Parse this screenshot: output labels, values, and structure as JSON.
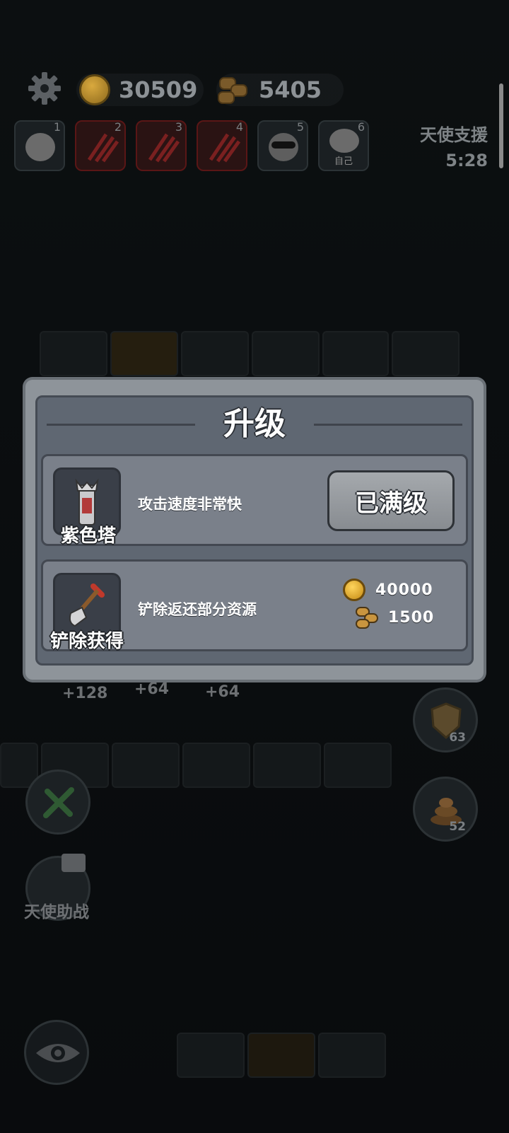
{
  "hud": {
    "coins": "30509",
    "wood": "5405",
    "angel_support_label": "天使支援",
    "angel_support_timer": "5:28"
  },
  "players": [
    {
      "num": "1",
      "state": "player"
    },
    {
      "num": "2",
      "state": "dead"
    },
    {
      "num": "3",
      "state": "dead"
    },
    {
      "num": "4",
      "state": "dead"
    },
    {
      "num": "5",
      "state": "player"
    },
    {
      "num": "6",
      "state": "self",
      "self_label": "自己"
    }
  ],
  "modal": {
    "title": "升级",
    "upgrade": {
      "name": "紫色塔",
      "description": "攻击速度非常快",
      "button": "已满级"
    },
    "remove": {
      "name": "铲除获得",
      "description": "铲除返还部分资源",
      "coins": "40000",
      "wood": "1500"
    }
  },
  "scene": {
    "income_labels": [
      "+128",
      "+64",
      "+64"
    ],
    "shield_count": "63",
    "poop_count": "52",
    "angel_help_label": "天使助战"
  },
  "colors": {
    "modal_frame": "#8e949a",
    "modal_panel": "#5f6772",
    "card": "#7a808a",
    "button": "#9a9ea3"
  }
}
